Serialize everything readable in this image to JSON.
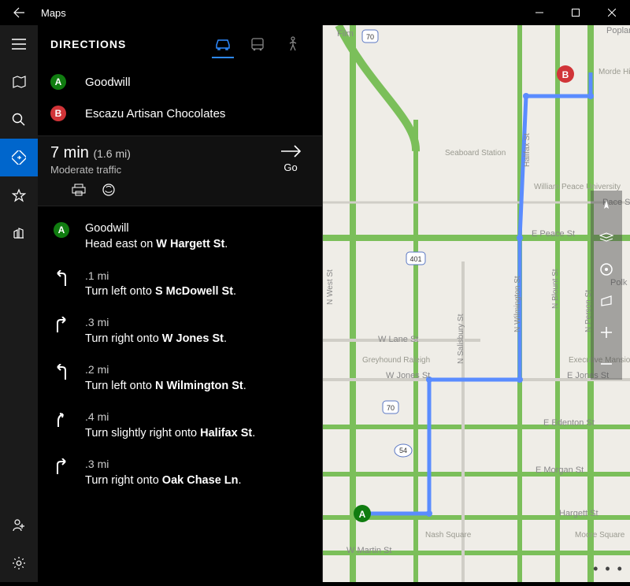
{
  "titlebar": {
    "app_title": "Maps"
  },
  "rail": {
    "items": [
      "menu",
      "map",
      "search",
      "directions",
      "favorites",
      "3dcities"
    ],
    "active": "directions"
  },
  "panel": {
    "heading": "DIRECTIONS",
    "modes": [
      {
        "id": "drive",
        "label": "Drive",
        "active": true
      },
      {
        "id": "transit",
        "label": "Transit",
        "active": false
      },
      {
        "id": "walk",
        "label": "Walk",
        "active": false
      }
    ],
    "start": "Goodwill",
    "end": "Escazu Artisan Chocolates",
    "summary": {
      "time": "7 min",
      "distance": "(1.6 mi)",
      "traffic": "Moderate traffic",
      "go_label": "Go"
    },
    "steps": [
      {
        "icon": "marker-a",
        "distance": "",
        "text_pre": "Goodwill",
        "text": "Head east on ",
        "bold": "W Hargett St",
        "text_post": "."
      },
      {
        "icon": "turn-left",
        "distance": ".1 mi",
        "text": "Turn left onto ",
        "bold": "S McDowell St",
        "text_post": "."
      },
      {
        "icon": "turn-right",
        "distance": ".3 mi",
        "text": "Turn right onto ",
        "bold": "W Jones St",
        "text_post": "."
      },
      {
        "icon": "turn-left",
        "distance": ".2 mi",
        "text": "Turn left onto ",
        "bold": "N Wilmington St",
        "text_post": "."
      },
      {
        "icon": "slight-right",
        "distance": ".4 mi",
        "text": "Turn slightly right onto ",
        "bold": "Halifax St",
        "text_post": "."
      },
      {
        "icon": "turn-right",
        "distance": ".3 mi",
        "text": "Turn right onto ",
        "bold": "Oak Chase Ln",
        "text_post": "."
      }
    ]
  },
  "map": {
    "streets": [
      "Poplar",
      "Pace St",
      "E Peace St",
      "Polk",
      "W Lane St",
      "N Salisbury St",
      "N Wilmington St",
      "N Blount St",
      "N Person St",
      "Halifax St",
      "E Jones St",
      "W Jones St",
      "E Edenton St",
      "E Morgan St",
      "Hargett St",
      "W Martin St",
      "N West St",
      "Film"
    ],
    "labels": [
      "Seaboard Station",
      "William Peace University",
      "Greyhound Raleigh",
      "Executive Mansion",
      "Nash Square",
      "Moore Square",
      "Morde Historic"
    ],
    "shields": [
      "70",
      "70",
      "54",
      "401"
    ],
    "markers": {
      "a": "A",
      "b": "B"
    }
  }
}
